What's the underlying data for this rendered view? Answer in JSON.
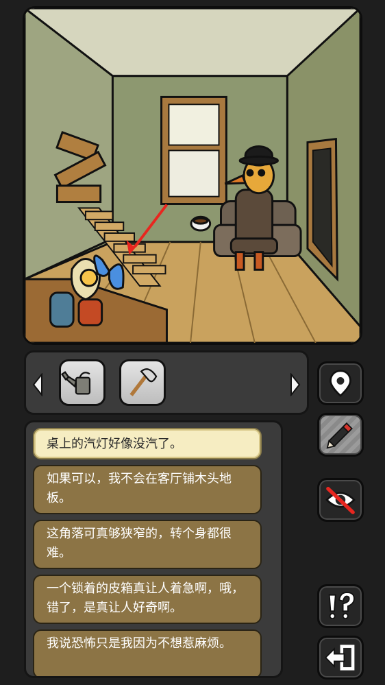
{
  "scene": {
    "name": "living-room",
    "hotspot_arrow_color": "#e8261f",
    "character": "bird-man-with-bowler-hat"
  },
  "inventory": {
    "items": [
      {
        "icon": "watering-can-icon"
      },
      {
        "icon": "axe-icon"
      }
    ],
    "prev_icon": "chevron-left-icon",
    "next_icon": "chevron-right-icon"
  },
  "side_buttons": [
    {
      "icon": "map-pin-icon"
    },
    {
      "icon": "pencil-icon"
    },
    {
      "icon": "eye-hidden-icon"
    },
    {
      "icon": "hint-icon"
    },
    {
      "icon": "exit-icon"
    }
  ],
  "dialog": {
    "lines": [
      {
        "text": "桌上的汽灯好像没汽了。",
        "selected": true
      },
      {
        "text": "如果可以，我不会在客厅铺木头地板。"
      },
      {
        "text": "这角落可真够狭窄的，转个身都很难。"
      },
      {
        "text": "一个锁着的皮箱真让人着急啊，哦，错了，是真让人好奇啊。"
      },
      {
        "text": "我说恐怖只是我因为不想惹麻烦。"
      }
    ]
  },
  "colors": {
    "panel": "#3b3b3b",
    "dialog_option": "#8c7445",
    "dialog_selected": "#f6edc2",
    "wall": "#8c956a",
    "floor": "#c9a25e"
  }
}
